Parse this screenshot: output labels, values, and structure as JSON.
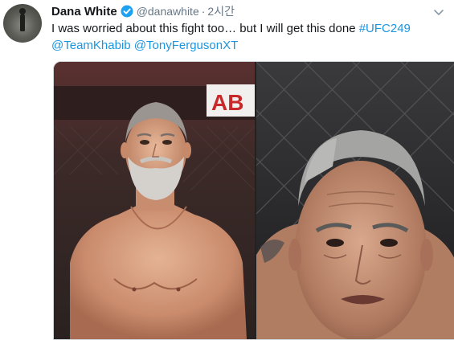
{
  "tweet": {
    "author_name": "Dana White",
    "handle": "@danawhite",
    "separator": "·",
    "time": "2시간",
    "text": "I was worried about this fight too… but I will get this done",
    "hashtag": "#UFC249",
    "mention_1": "@TeamKhabib",
    "mention_2": "@TonyFergusonXT"
  },
  "media": {
    "sign_text": "AB"
  },
  "icons": [
    "verified-badge-icon",
    "chevron-down-icon"
  ],
  "colors": {
    "link": "#1b95e0",
    "verified": "#1da1f2",
    "text": "#14171a",
    "muted": "#657786"
  }
}
